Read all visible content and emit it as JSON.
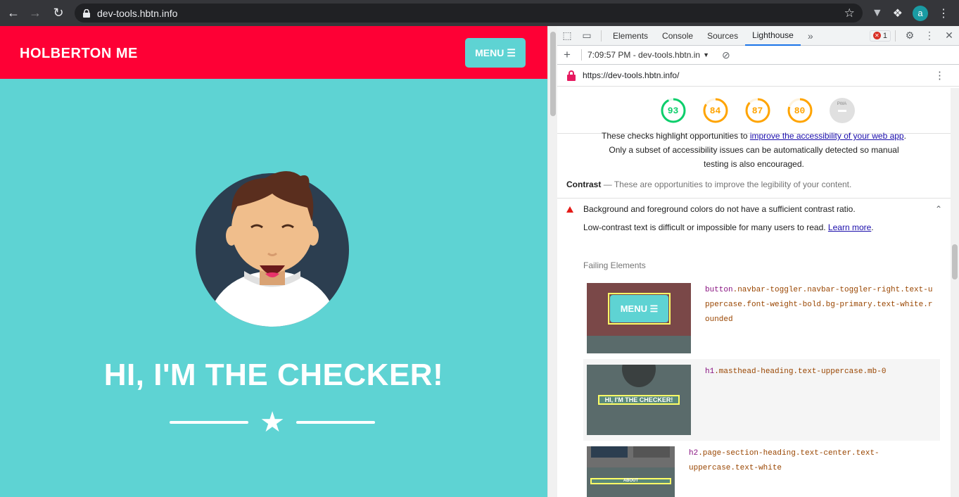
{
  "browser": {
    "url": "dev-tools.hbtn.info",
    "profile_initial": "a"
  },
  "site": {
    "brand": "HOLBERTON ME",
    "menu_label": "MENU",
    "hero_title": "HI, I'M THE CHECKER!",
    "colors": {
      "navbar": "#fe0035",
      "primary": "#5ed3d3"
    }
  },
  "devtools": {
    "tabs": [
      "Elements",
      "Console",
      "Sources",
      "Lighthouse"
    ],
    "active_tab": "Lighthouse",
    "error_count": "1",
    "report_selector": "7:09:57 PM - dev-tools.hbtn.in",
    "report_url": "https://dev-tools.hbtn.info/",
    "scores": [
      {
        "value": "93",
        "color": "#0cce6b",
        "fraction": 0.93
      },
      {
        "value": "84",
        "color": "#ffa400",
        "fraction": 0.84
      },
      {
        "value": "87",
        "color": "#ffa400",
        "fraction": 0.87
      },
      {
        "value": "80",
        "color": "#ffa400",
        "fraction": 0.8
      }
    ],
    "pwa_label": "PWA",
    "intro_pre": "These checks highlight opportunities to ",
    "intro_link": "improve the accessibility of your web app",
    "intro_post": ". Only a subset of accessibility issues can be automatically detected so manual testing is also encouraged.",
    "contrast_title": "Contrast",
    "contrast_desc": "These are opportunities to improve the legibility of your content.",
    "audit_title": "Background and foreground colors do not have a sufficient contrast ratio.",
    "audit_desc": "Low-contrast text is difficult or impossible for many users to read. ",
    "learn_more": "Learn more",
    "failing_label": "Failing Elements",
    "failing": [
      {
        "tag": "button",
        "rest": ".navbar-toggler.navbar-toggler-right.text-uppercase.font-weight-bold.bg-primary.text-white.rounded",
        "thumb_text": "MENU"
      },
      {
        "tag": "h1",
        "rest": ".masthead-heading.text-uppercase.mb-0",
        "thumb_text": "HI, I'M THE CHECKER!"
      },
      {
        "tag": "h2",
        "rest": ".page-section-heading.text-center.text-uppercase.text-white",
        "thumb_text": "ABOUT"
      }
    ]
  }
}
